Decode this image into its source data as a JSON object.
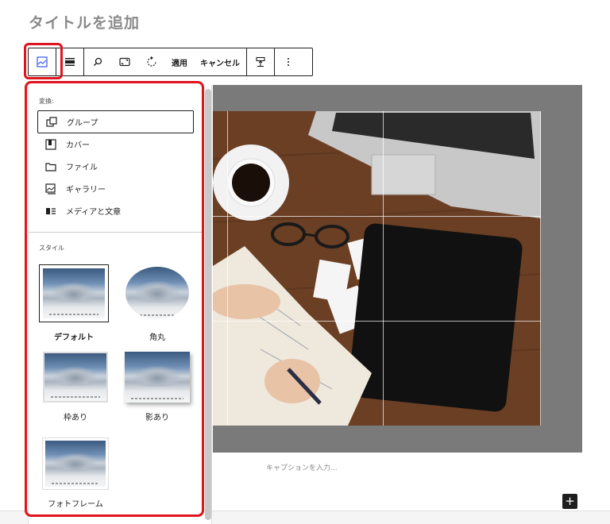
{
  "page": {
    "title": "タイトルを追加"
  },
  "toolbar": {
    "apply_label": "適用",
    "cancel_label": "キャンセル",
    "icons": [
      "image-icon",
      "align-icon",
      "search-icon",
      "aspect-ratio-icon",
      "rotate-icon",
      "apply",
      "cancel",
      "caption-position-icon",
      "more-options-icon"
    ]
  },
  "transform": {
    "label": "変換:",
    "items": [
      {
        "label": "グループ",
        "icon": "group-icon",
        "active": true
      },
      {
        "label": "カバー",
        "icon": "cover-icon"
      },
      {
        "label": "ファイル",
        "icon": "file-icon"
      },
      {
        "label": "ギャラリー",
        "icon": "gallery-icon"
      },
      {
        "label": "メディアと文章",
        "icon": "media-text-icon"
      }
    ]
  },
  "styles": {
    "label": "スタイル",
    "items": [
      {
        "label": "デフォルト",
        "selected": true
      },
      {
        "label": "角丸"
      },
      {
        "label": "枠あり"
      },
      {
        "label": "影あり"
      },
      {
        "label": "フォトフレーム"
      }
    ]
  },
  "image": {
    "caption_placeholder": "キャプションを入力..."
  },
  "colors": {
    "highlight": "#e0141e",
    "accent": "#1e1e1e",
    "image_backdrop": "#7a7a7a"
  }
}
